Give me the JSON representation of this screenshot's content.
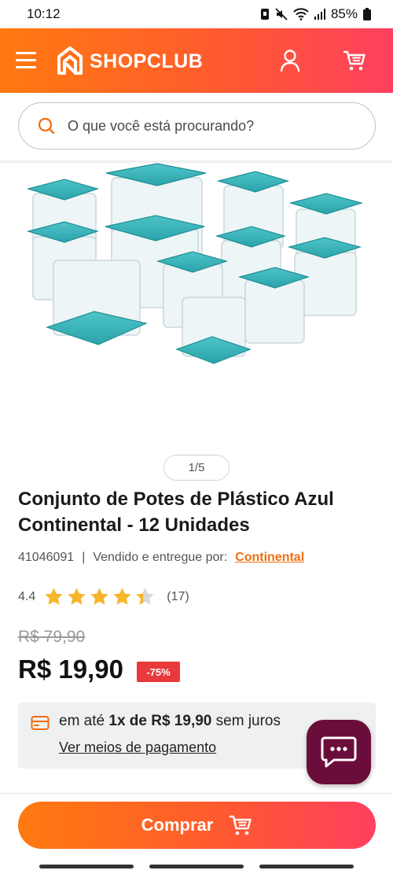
{
  "status": {
    "time": "10:12",
    "battery": "85%"
  },
  "header": {
    "brand": "SHOPCLUB"
  },
  "search": {
    "placeholder": "O que você está procurando?"
  },
  "gallery": {
    "pager": "1/5"
  },
  "product": {
    "title": "Conjunto de Potes de Plástico Azul Continental - 12 Unidades",
    "sku": "41046091",
    "separator": "|",
    "seller_prefix": "Vendido e entregue por:",
    "seller": "Continental",
    "rating": "4.4",
    "rating_value": 4.4,
    "rating_max": 5,
    "reviews": "(17)",
    "old_price": "R$ 79,90",
    "price": "R$ 19,90",
    "discount": "-75%"
  },
  "installments": {
    "prefix": "em até",
    "plan": "1x de R$ 19,90",
    "suffix": "sem juros",
    "link": "Ver meios de pagamento"
  },
  "actions": {
    "buy": "Comprar"
  },
  "colors": {
    "brand_start": "#ff7a10",
    "brand_end": "#ff3f5f",
    "accent": "#ef6d0f",
    "chat": "#6b0d3a",
    "discount": "#e83a3a",
    "star": "#f7b52c"
  },
  "icons": [
    "menu-icon",
    "shopclub-logo-icon",
    "user-icon",
    "cart-icon",
    "search-icon",
    "star-icon",
    "credit-card-icon",
    "chat-icon"
  ]
}
